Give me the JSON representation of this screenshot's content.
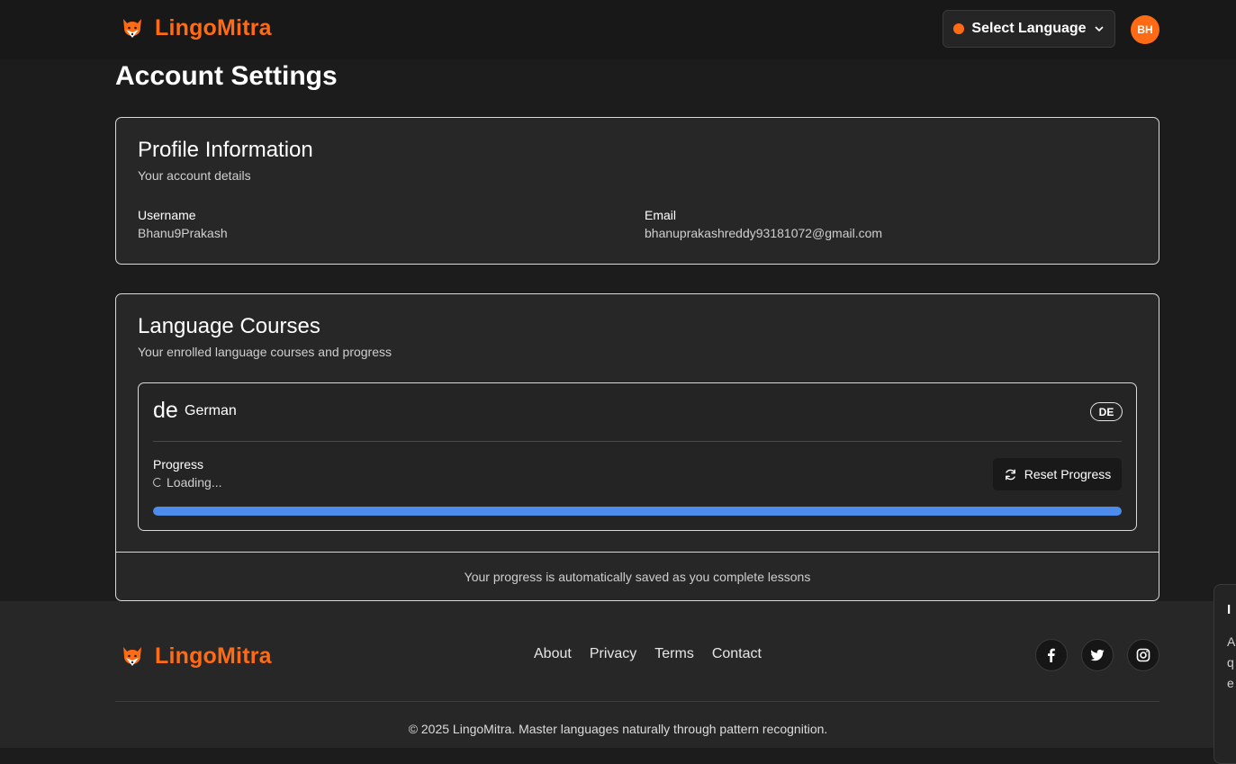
{
  "header": {
    "brand": "LingoMitra",
    "language_button": "Select Language",
    "avatar_initials": "BH",
    "colors": {
      "accent": "#ff6a14",
      "background": "#1c1c1c"
    }
  },
  "page": {
    "title": "Account Settings"
  },
  "profile": {
    "title": "Profile Information",
    "description": "Your account details",
    "username_label": "Username",
    "username_value": "Bhanu9Prakash",
    "email_label": "Email",
    "email_value": "bhanuprakashreddy93181072@gmail.com"
  },
  "courses": {
    "title": "Language Courses",
    "description": "Your enrolled language courses and progress",
    "items": [
      {
        "code": "de",
        "name": "German",
        "badge": "DE",
        "progress_label": "Progress",
        "progress_status": "Loading...",
        "reset_label": "Reset Progress",
        "progress_fill": 1.0
      }
    ],
    "footer_note": "Your progress is automatically saved as you complete lessons"
  },
  "footer": {
    "brand": "LingoMitra",
    "links": [
      "About",
      "Privacy",
      "Terms",
      "Contact"
    ],
    "social_icons": [
      "facebook-icon",
      "twitter-icon",
      "instagram-icon"
    ],
    "copyright": "© 2025 LingoMitra. Master languages naturally through pattern recognition."
  },
  "toast": {
    "title": "I",
    "body": "A q e"
  }
}
